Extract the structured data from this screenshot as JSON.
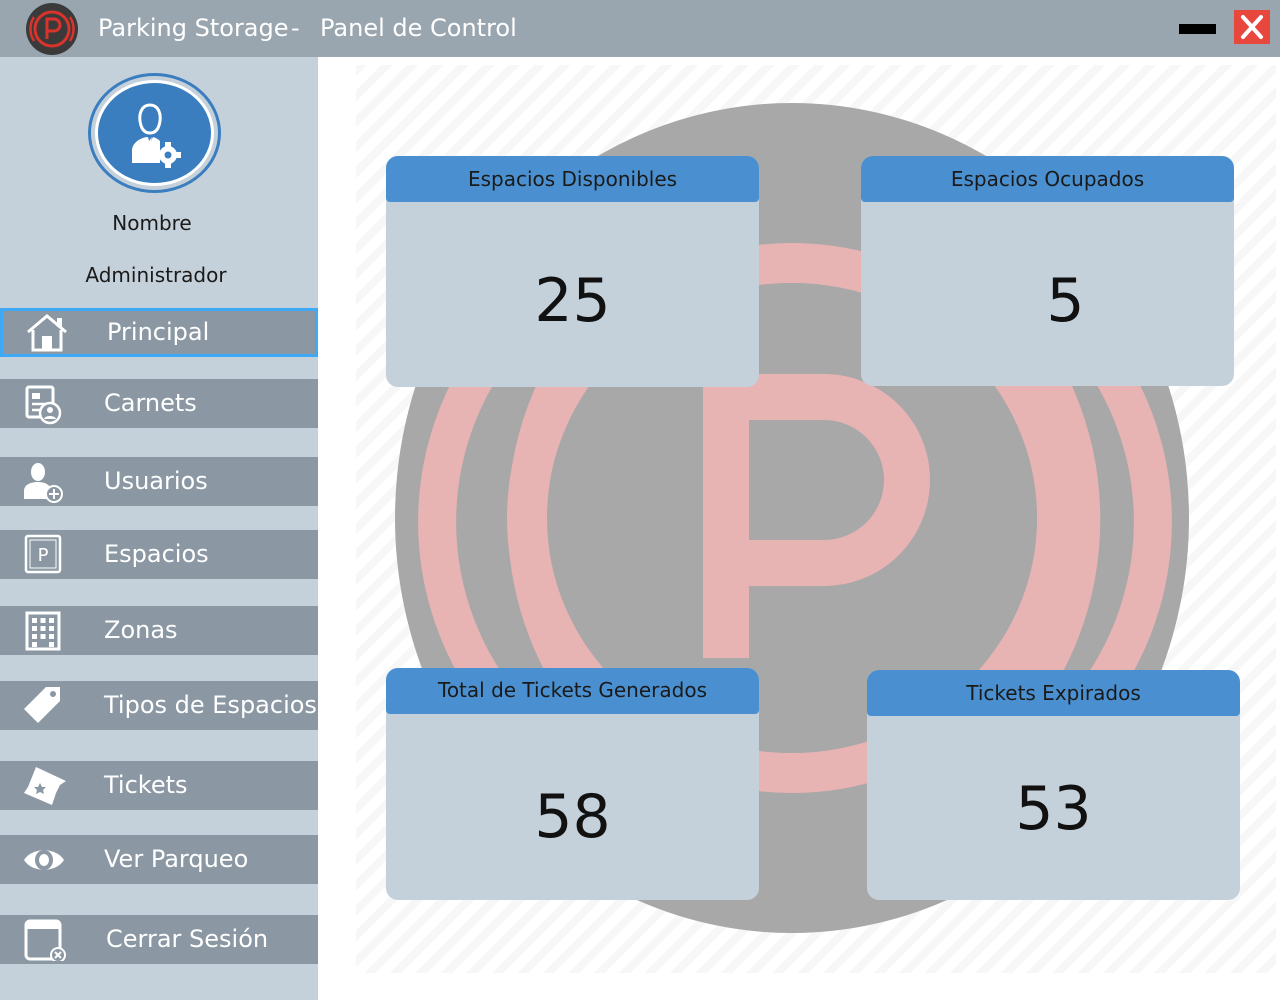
{
  "window": {
    "app_name": "Parking Storage",
    "separator": "-",
    "section": "Panel de Control",
    "minimize_icon": "minimize-icon",
    "close_icon": "close-icon"
  },
  "user": {
    "name": "Nombre",
    "role": "Administrador",
    "avatar_icon": "admin-user-gear-icon"
  },
  "sidebar": {
    "items": [
      {
        "label": "Principal",
        "icon": "home-icon",
        "active": true
      },
      {
        "label": "Carnets",
        "icon": "id-card-icon"
      },
      {
        "label": "Usuarios",
        "icon": "add-user-icon"
      },
      {
        "label": "Espacios",
        "icon": "parking-sign-icon"
      },
      {
        "label": "Zonas",
        "icon": "building-icon"
      },
      {
        "label": "Tipos de Espacios",
        "icon": "tag-icon"
      },
      {
        "label": "Tickets",
        "icon": "ticket-icon"
      },
      {
        "label": "Ver Parqueo",
        "icon": "eye-icon"
      },
      {
        "label": "Cerrar Sesión",
        "icon": "logout-window-icon"
      }
    ]
  },
  "cards": [
    {
      "title": "Espacios Disponibles",
      "value": "25"
    },
    {
      "title": "Espacios Ocupados",
      "value": "5"
    },
    {
      "title": "Total de Tickets Generados",
      "value": "58"
    },
    {
      "title": "Tickets Expirados",
      "value": "53"
    }
  ],
  "colors": {
    "titlebar": "#9aa6af",
    "sidebar": "#c5d1da",
    "nav_item": "#8b98a3",
    "active_border": "#3fa9f5",
    "card_header": "#4a90d0",
    "card_body": "#c5d1da",
    "close": "#e8473e"
  }
}
